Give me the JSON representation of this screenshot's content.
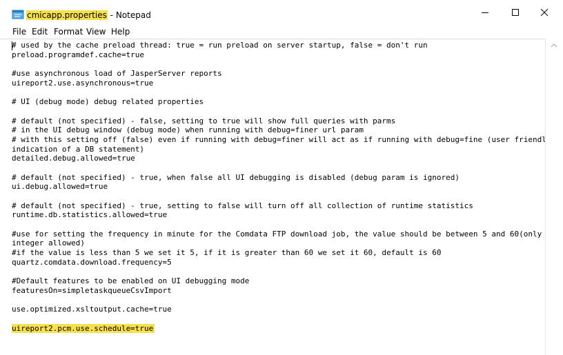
{
  "window": {
    "title_file": "cmicapp.properties",
    "title_app": " - Notepad"
  },
  "menu": [
    "File",
    "Edit",
    "Format",
    "View",
    "Help"
  ],
  "editor": {
    "lines": [
      "# used by the cache preload thread: true = run preload on server startup, false = don't run",
      "preload.programdef.cache=true",
      "",
      "#use asynchronous load of JasperServer reports",
      "uireport2.use.asynchronous=true",
      "",
      "# UI (debug mode) debug related properties",
      "",
      "# default (not specified) - false, setting to true will show full queries with parms",
      "# in the UI debug window (debug mode) when running with debug=finer url param",
      "# with this setting off (false) even if running with debug=finer will act as if running with debug=fine (user friendly",
      "indication of a DB statement)",
      "detailed.debug.allowed=true",
      "",
      "# default (not specified) - true, when false all UI debugging is disabled (debug param is ignored)",
      "ui.debug.allowed=true",
      "",
      "# default (not specified) - true, setting to false will turn off all collection of runtime statistics",
      "runtime.db.statistics.allowed=true",
      "",
      "#use for setting the frequency in minute for the Comdata FTP download job, the value should be between 5 and 60(only",
      "integer allowed)",
      "#if the value is less than 5 we set it 5, if it is greater than 60 we set it 60, default is 60",
      "quartz.comdata.download.frequency=5",
      "",
      "#Default features to be enabled on UI debugging mode",
      "featuresOn=simpletaskqueueCsvImport",
      "",
      "use.optimized.xsltoutput.cache=true",
      "",
      "uireport2.pcm.use.schedule=true"
    ],
    "highlighted_line": 30
  },
  "colors": {
    "highlight": "#f7e14b",
    "text": "#000000",
    "background": "#ffffff"
  },
  "icons": {
    "app": "notepad-icon",
    "minimize": "minimize-icon",
    "maximize": "maximize-icon",
    "close": "close-icon",
    "scroll_up": "chevron-up-icon"
  }
}
